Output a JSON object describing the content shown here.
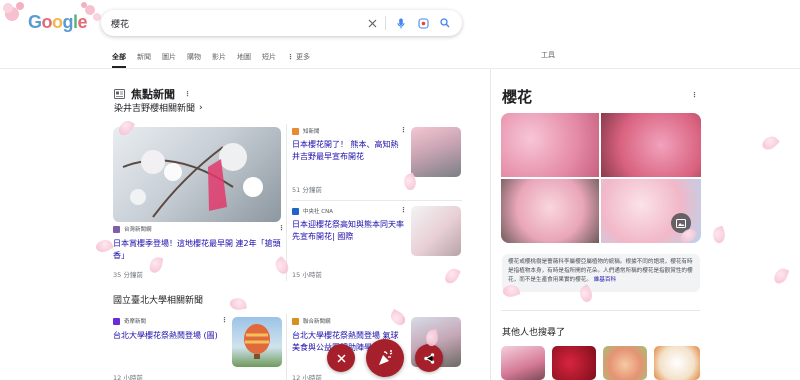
{
  "logo": {
    "letters": [
      "G",
      "o",
      "o",
      "g",
      "l",
      "e"
    ],
    "colors": [
      "#5a9bd4",
      "#e26a73",
      "#f2b84b",
      "#5a9bd4",
      "#5cb37a",
      "#e26a73"
    ]
  },
  "search": {
    "value": "櫻花",
    "icons": [
      "close-icon",
      "mic-icon",
      "lens-icon",
      "search-icon"
    ]
  },
  "tabs": {
    "items": [
      "全部",
      "新聞",
      "圖片",
      "購物",
      "影片",
      "地圖",
      "短片",
      "更多"
    ],
    "active": "全部",
    "tools": "工具"
  },
  "news": {
    "header": "焦點新聞",
    "section1": "染井吉野櫻相關新聞",
    "section2": "國立臺北大學相關新聞",
    "cards": [
      {
        "source": "台灣新聞網",
        "title": "日本賞櫻季登場！這地櫻花最早開 連2年「搶頭香」",
        "time": "35 分鐘前"
      },
      {
        "source": "知新聞",
        "title": "日本櫻花開了！ 熊本、高知熱井吉野最早宣布開花",
        "time": "51 分鐘前"
      },
      {
        "source": "中央社 CNA",
        "title": "日本迎櫻花祭高知與熊本同天率先宣布開花| 國際",
        "time": "15 小時前"
      },
      {
        "source": "奇摩新聞",
        "title": "台北大學櫻花祭熱鬧登場 (圖)",
        "time": "12 小時前"
      },
      {
        "source": "聯合新聞網",
        "title": "台北大學櫻花祭熱鬧登場 氣球美食與公益團體助陣學子",
        "time": "12 小時前"
      }
    ]
  },
  "kp": {
    "title": "櫻花",
    "description": "櫻花或櫻桃樹是薔薇科李屬櫻亞屬植物的統稱。根據不同的語境，櫻花有時是指植物本身，有時是指所開的花朵。人們通常所稱的櫻花是指觀賞性的櫻花，而不是生產食用果實的櫻花。",
    "link": "維基百科",
    "people_also": "其他人也搜尋了"
  },
  "colors": {
    "link": "#1a0dab",
    "fab": "#a6202b"
  }
}
